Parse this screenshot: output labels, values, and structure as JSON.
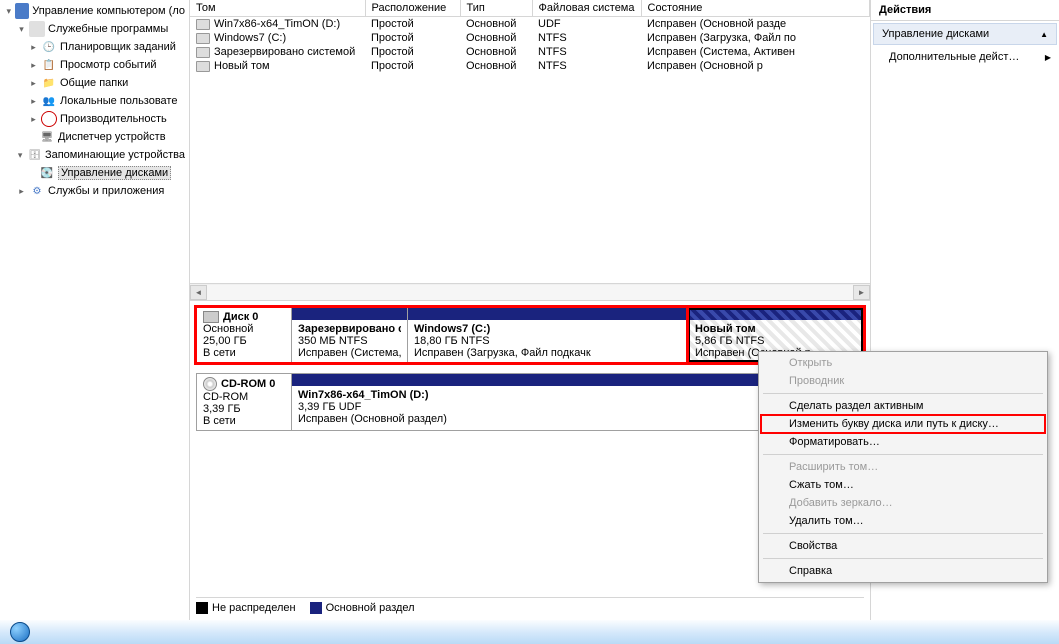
{
  "tree": {
    "root": "Управление компьютером (ло",
    "sys_tools": "Служебные программы",
    "scheduler": "Планировщик заданий",
    "event": "Просмотр событий",
    "shared": "Общие папки",
    "users": "Локальные пользовате",
    "perf": "Производительность",
    "devmgr": "Диспетчер устройств",
    "storage": "Запоминающие устройства",
    "diskmgmt": "Управление дисками",
    "services": "Службы и приложения"
  },
  "cols": {
    "tom": "Том",
    "layout": "Расположение",
    "type": "Тип",
    "fs": "Файловая система",
    "status": "Состояние"
  },
  "vols": [
    {
      "name": "Win7x86-x64_TimON (D:)",
      "layout": "Простой",
      "type": "Основной",
      "fs": "UDF",
      "status": "Исправен (Основной разде"
    },
    {
      "name": "Windows7 (C:)",
      "layout": "Простой",
      "type": "Основной",
      "fs": "NTFS",
      "status": "Исправен (Загрузка, Файл по"
    },
    {
      "name": "Зарезервировано системой",
      "layout": "Простой",
      "type": "Основной",
      "fs": "NTFS",
      "status": "Исправен (Система, Активен"
    },
    {
      "name": "Новый том",
      "layout": "Простой",
      "type": "Основной",
      "fs": "NTFS",
      "status": "Исправен (Основной р"
    }
  ],
  "disk0": {
    "title": "Диск 0",
    "type": "Основной",
    "size": "25,00 ГБ",
    "state": "В сети",
    "p1": {
      "name": "Зарезервировано с",
      "info": "350 МБ NTFS",
      "stat": "Исправен (Система,"
    },
    "p2": {
      "name": "Windows7  (C:)",
      "info": "18,80 ГБ NTFS",
      "stat": "Исправен (Загрузка, Файл подкачк"
    },
    "p3": {
      "name": "Новый том",
      "info": "5,86 ГБ NTFS",
      "stat": "Исправен (Основной р"
    }
  },
  "cd0": {
    "title": "CD-ROM 0",
    "type": "CD-ROM",
    "size": "3,39 ГБ",
    "state": "В сети",
    "p1": {
      "name": "Win7x86-x64_TimON (D:)",
      "info": "3,39 ГБ UDF",
      "stat": "Исправен (Основной раздел)"
    }
  },
  "legend": {
    "unalloc": "Не распределен",
    "primary": "Основной раздел"
  },
  "actions": {
    "hdr": "Действия",
    "sub": "Управление дисками",
    "more": "Дополнительные дейст…"
  },
  "ctx": {
    "open": "Открыть",
    "explorer": "Проводник",
    "active": "Сделать раздел активным",
    "change": "Изменить букву диска или путь к диску…",
    "format": "Форматировать…",
    "extend": "Расширить том…",
    "shrink": "Сжать том…",
    "mirror": "Добавить зеркало…",
    "delete": "Удалить том…",
    "props": "Свойства",
    "help": "Справка"
  }
}
